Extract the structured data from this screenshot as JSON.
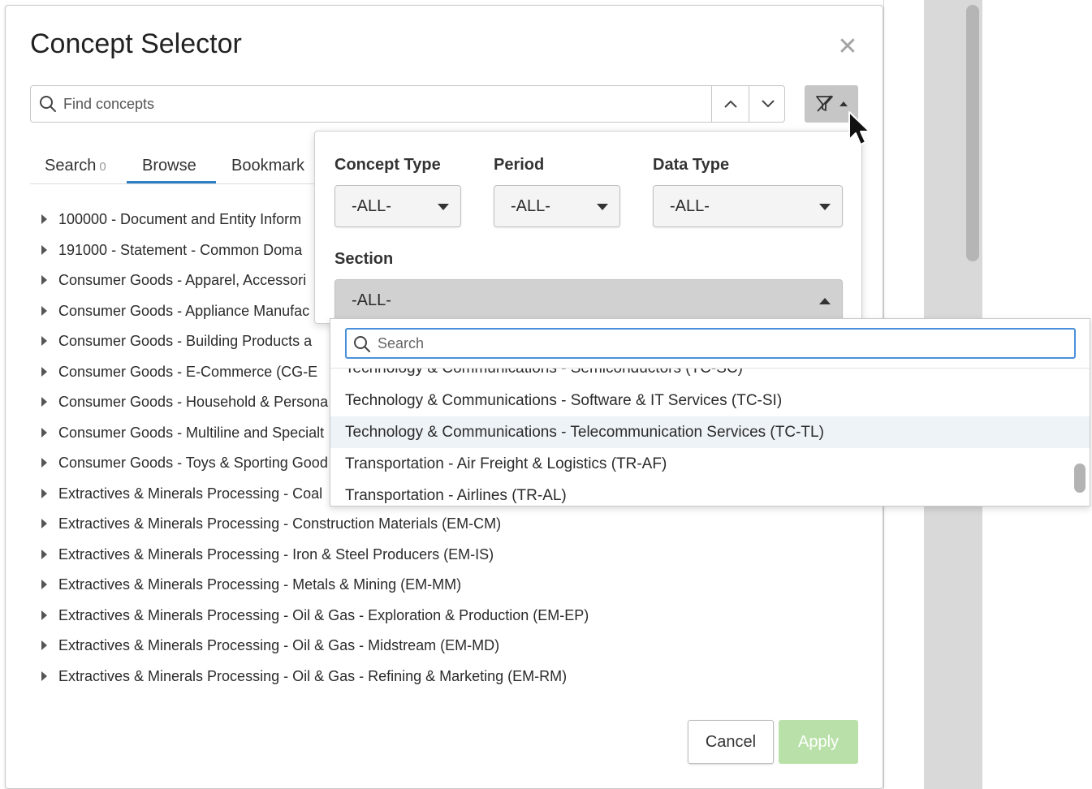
{
  "dialog": {
    "title": "Concept Selector",
    "close_glyph": "✕"
  },
  "search": {
    "placeholder": "Find concepts",
    "up_glyph": "^",
    "down_glyph": "v"
  },
  "tabs": [
    {
      "label": "Search",
      "count": "0"
    },
    {
      "label": "Browse"
    },
    {
      "label": "Bookmark"
    }
  ],
  "tree": {
    "items": [
      "100000 - Document and Entity Inform",
      "191000 - Statement - Common Doma",
      "Consumer Goods - Apparel, Accessori",
      "Consumer Goods - Appliance Manufac",
      "Consumer Goods - Building Products a",
      "Consumer Goods - E-Commerce (CG-E",
      "Consumer Goods - Household & Persona",
      "Consumer Goods - Multiline and Specialt",
      "Consumer Goods - Toys & Sporting Good",
      "Extractives & Minerals Processing - Coal",
      "Extractives & Minerals Processing - Construction Materials (EM-CM)",
      "Extractives & Minerals Processing - Iron & Steel Producers (EM-IS)",
      "Extractives & Minerals Processing - Metals & Mining (EM-MM)",
      "Extractives & Minerals Processing - Oil & Gas - Exploration & Production (EM-EP)",
      "Extractives & Minerals Processing - Oil & Gas - Midstream (EM-MD)",
      "Extractives & Minerals Processing - Oil & Gas - Refining & Marketing (EM-RM)"
    ]
  },
  "filters": {
    "concept_type": {
      "label": "Concept Type",
      "value": "-ALL-"
    },
    "period": {
      "label": "Period",
      "value": "-ALL-"
    },
    "data_type": {
      "label": "Data Type",
      "value": "-ALL-"
    },
    "section": {
      "label": "Section",
      "value": "-ALL-"
    }
  },
  "section_dropdown": {
    "search_placeholder": "Search",
    "options": [
      "Technology & Communications - Semiconductors (TC-SC)",
      "Technology & Communications - Software & IT Services (TC-SI)",
      "Technology & Communications - Telecommunication Services (TC-TL)",
      "Transportation - Air Freight & Logistics (TR-AF)",
      "Transportation - Airlines (TR-AL)"
    ],
    "highlighted_index": 2
  },
  "buttons": {
    "cancel": "Cancel",
    "apply": "Apply"
  },
  "background": {
    "fragment_text": "—— ..."
  },
  "colors": {
    "accent": "#2f7fc4",
    "apply_disabled": "#b8e0a8",
    "focus_ring": "#4a90d9",
    "highlight_row": "#eef3f8"
  }
}
